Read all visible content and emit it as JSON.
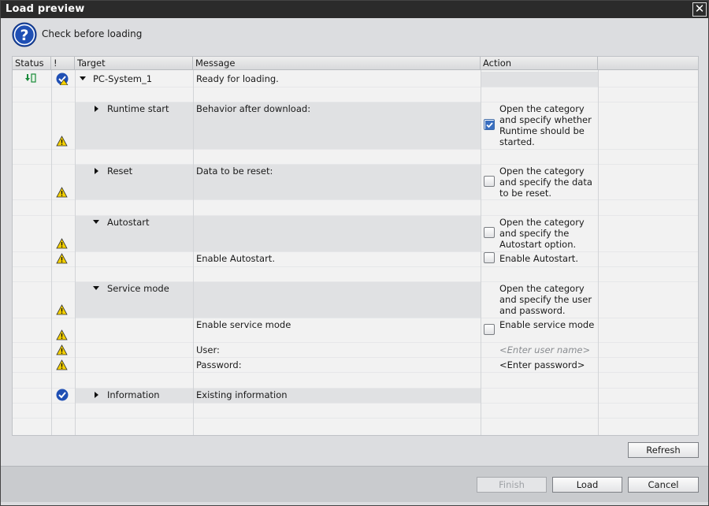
{
  "window": {
    "title": "Load preview",
    "close_glyph": "✕"
  },
  "header": {
    "title": "Check before loading",
    "icon": "question-icon"
  },
  "table": {
    "columns": [
      "Status",
      "!",
      "Target",
      "Message",
      "Action"
    ],
    "rows": {
      "pc_system": {
        "target": "PC-System_1",
        "message": "Ready for loading."
      },
      "runtime": {
        "target": "Runtime start",
        "message": "Behavior after download:",
        "action": "Open the category and specify whether Runtime should be started.",
        "checked": true
      },
      "reset": {
        "target": "Reset",
        "message": "Data to be reset:",
        "action": "Open the category and specify the data to be reset.",
        "checked": false
      },
      "autostart": {
        "target": "Autostart",
        "action": "Open the category and specify the Autostart option.",
        "checked": false
      },
      "enable_autostart": {
        "message": "Enable Autostart.",
        "action": "Enable Autostart.",
        "checked": false
      },
      "service_mode": {
        "target": "Service mode",
        "action": "Open the category and specify the user and password."
      },
      "enable_service": {
        "message": "Enable service mode",
        "action": "Enable service mode",
        "checked": false
      },
      "user": {
        "message": "User:",
        "placeholder": "<Enter user name>"
      },
      "password": {
        "message": "Password:",
        "value": "<Enter password>"
      },
      "information": {
        "target": "Information",
        "message": "Existing information"
      }
    }
  },
  "buttons": {
    "refresh": "Refresh",
    "finish": "Finish",
    "load": "Load",
    "cancel": "Cancel"
  },
  "colors": {
    "titlebar": "#2b2b2b",
    "accent_blue": "#1f4fb4",
    "warning_yellow": "#f5d000"
  }
}
